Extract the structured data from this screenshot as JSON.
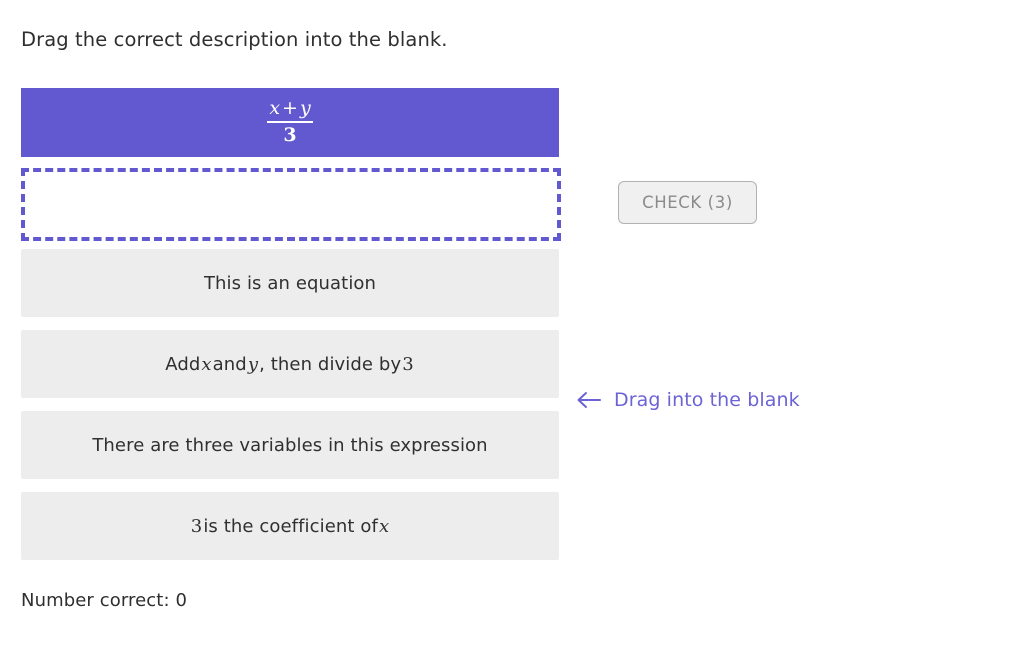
{
  "prompt": "Drag the correct description into the blank.",
  "expression": {
    "numerator_left": "x",
    "numerator_operator": "+",
    "numerator_right": "y",
    "denominator": "3",
    "card_color": "#6259d0"
  },
  "blank": {
    "content": "",
    "border_color": "#6259d0"
  },
  "options": [
    {
      "parts": [
        {
          "type": "text",
          "value": "This is an equation"
        }
      ]
    },
    {
      "parts": [
        {
          "type": "text",
          "value": "Add "
        },
        {
          "type": "var",
          "value": "x"
        },
        {
          "type": "text",
          "value": " and "
        },
        {
          "type": "var",
          "value": "y"
        },
        {
          "type": "text",
          "value": ", then divide by "
        },
        {
          "type": "num",
          "value": "3"
        }
      ]
    },
    {
      "parts": [
        {
          "type": "text",
          "value": "There are three variables in this expression"
        }
      ]
    },
    {
      "parts": [
        {
          "type": "num",
          "value": "3"
        },
        {
          "type": "text",
          "value": " is the coefficient of "
        },
        {
          "type": "var",
          "value": "x"
        }
      ]
    }
  ],
  "check_button": {
    "label": "CHECK (3)",
    "text_color": "#8b8b8b",
    "background": "#f0f0f0"
  },
  "drag_hint": {
    "icon": "arrow-left-icon",
    "label": "Drag into the blank",
    "color": "#6c63d6"
  },
  "status": {
    "label": "Number correct: 0"
  }
}
